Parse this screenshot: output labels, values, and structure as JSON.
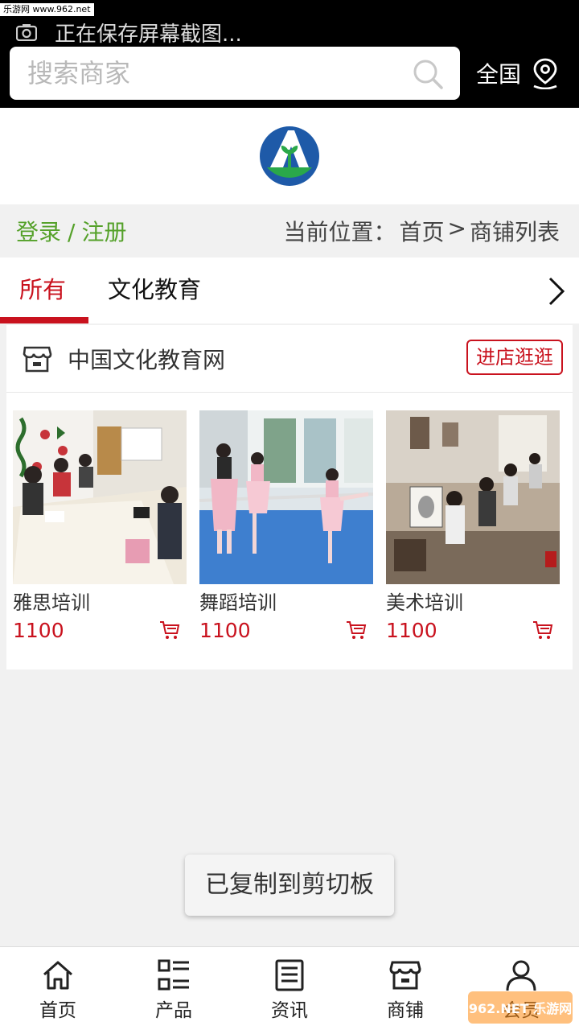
{
  "watermark_top": "乐游网 www.962.net",
  "status": {
    "text": "正在保存屏幕截图..."
  },
  "search": {
    "placeholder": "搜索商家",
    "value": ""
  },
  "region": {
    "label": "全国"
  },
  "auth": {
    "login": "登录",
    "sep": "/",
    "register": "注册"
  },
  "breadcrumb": {
    "prefix": "当前位置：",
    "home": "首页",
    "arrow": ">",
    "current": "商铺列表"
  },
  "tabs": [
    {
      "label": "所有",
      "active": true
    },
    {
      "label": "文化教育",
      "active": false
    }
  ],
  "shop": {
    "name": "中国文化教育网",
    "visit_button": "进店逛逛",
    "products": [
      {
        "name": "雅思培训",
        "price": "1100"
      },
      {
        "name": "舞蹈培训",
        "price": "1100"
      },
      {
        "name": "美术培训",
        "price": "1100"
      }
    ]
  },
  "toast": "已复制到剪切板",
  "nav": [
    {
      "label": "首页",
      "icon": "home-icon"
    },
    {
      "label": "产品",
      "icon": "grid-list-icon"
    },
    {
      "label": "资讯",
      "icon": "news-icon"
    },
    {
      "label": "商铺",
      "icon": "store-icon"
    },
    {
      "label": "会员",
      "icon": "user-icon"
    }
  ],
  "watermark_bottom": "962.NET 乐游网",
  "colors": {
    "accent": "#c9121e",
    "green": "#55a12a",
    "topbar": "#000000"
  }
}
